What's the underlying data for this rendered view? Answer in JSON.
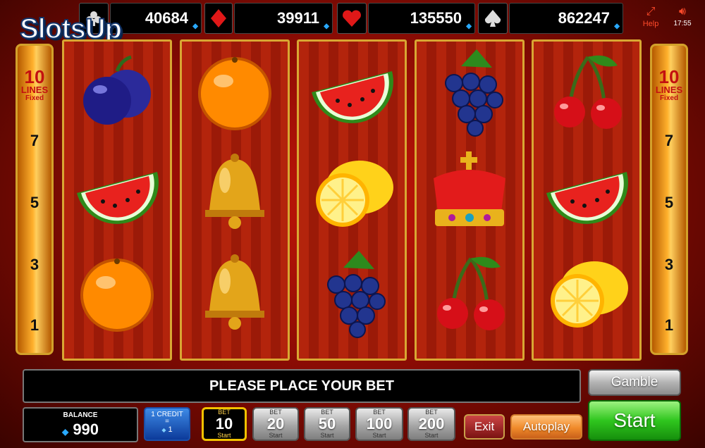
{
  "header": {
    "jackpots": [
      {
        "suit": "club-icon",
        "value": "40684"
      },
      {
        "suit": "diamond-icon",
        "value": "39911"
      },
      {
        "suit": "heart-icon",
        "value": "135550"
      },
      {
        "suit": "spade-icon",
        "value": "862247"
      }
    ],
    "help_label": "Help",
    "clock": "17:55",
    "logo_text": "SlotsUp"
  },
  "lines_panel": {
    "count": "10",
    "label": "LINES",
    "sub": "Fixed",
    "ticks": [
      "7",
      "5",
      "3",
      "1"
    ]
  },
  "reels": [
    [
      "plum",
      "watermelon",
      "orange"
    ],
    [
      "orange",
      "bell",
      "bell"
    ],
    [
      "watermelon",
      "lemon",
      "grapes"
    ],
    [
      "grapes",
      "crown",
      "cherry"
    ],
    [
      "cherry",
      "watermelon",
      "lemon"
    ]
  ],
  "message": "PLEASE PLACE YOUR BET",
  "balance": {
    "label": "BALANCE",
    "value": "990"
  },
  "credit": {
    "label": "1 CREDIT",
    "eq": "=",
    "value": "1"
  },
  "bets": [
    {
      "top": "BET",
      "value": "10",
      "bottom": "Start",
      "active": true
    },
    {
      "top": "BET",
      "value": "20",
      "bottom": "Start",
      "active": false
    },
    {
      "top": "BET",
      "value": "50",
      "bottom": "Start",
      "active": false
    },
    {
      "top": "BET",
      "value": "100",
      "bottom": "Start",
      "active": false
    },
    {
      "top": "BET",
      "value": "200",
      "bottom": "Start",
      "active": false
    }
  ],
  "buttons": {
    "gamble": "Gamble",
    "start": "Start",
    "exit": "Exit",
    "autoplay": "Autoplay"
  },
  "colors": {
    "accent_gold": "#d8a733",
    "start_green": "#2fc61e",
    "exit_red": "#9b1b1b",
    "autoplay_orange": "#f08a2a"
  }
}
